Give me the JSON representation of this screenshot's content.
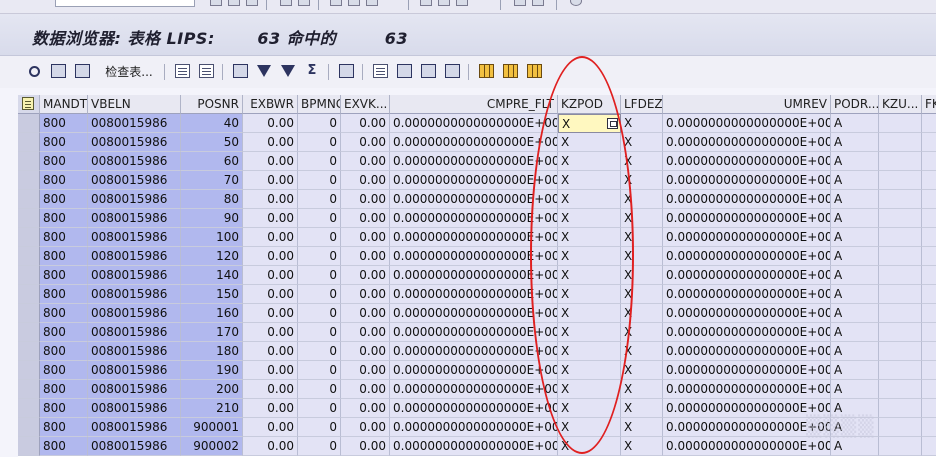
{
  "title": {
    "text": "数据浏览器: 表格 LIPS:       63 命中的        63"
  },
  "toolbar": {
    "check_table_label": "检查表...",
    "icons": [
      "display-icon",
      "find-icon",
      "refresh-icon",
      "check-table-icon",
      "details-icon",
      "choose-icon",
      "print-icon",
      "filter-icon",
      "set-filter-icon",
      "sum-icon",
      "ABC-analysis-icon",
      "export-icon",
      "sort-icon",
      "layout-icon",
      "grid-icon",
      "change-layout-icon",
      "select-layout-icon"
    ]
  },
  "table": {
    "columns": [
      "MANDT",
      "VBELN",
      "POSNR",
      "EXBWR",
      "BPMNG",
      "EXVK...",
      "CMPRE_FLT",
      "KZPOD",
      "LFDEZ",
      "UMREV",
      "PODR...",
      "KZU...",
      "FK"
    ],
    "rows": [
      [
        "800",
        "0080015986",
        "40",
        "0.00",
        "0",
        "0.00",
        "0.0000000000000000E+00",
        "X",
        "X",
        "0.0000000000000000E+00",
        "A",
        "",
        ""
      ],
      [
        "800",
        "0080015986",
        "50",
        "0.00",
        "0",
        "0.00",
        "0.0000000000000000E+00",
        "X",
        "X",
        "0.0000000000000000E+00",
        "A",
        "",
        ""
      ],
      [
        "800",
        "0080015986",
        "60",
        "0.00",
        "0",
        "0.00",
        "0.0000000000000000E+00",
        "X",
        "X",
        "0.0000000000000000E+00",
        "A",
        "",
        ""
      ],
      [
        "800",
        "0080015986",
        "70",
        "0.00",
        "0",
        "0.00",
        "0.0000000000000000E+00",
        "X",
        "X",
        "0.0000000000000000E+00",
        "A",
        "",
        ""
      ],
      [
        "800",
        "0080015986",
        "80",
        "0.00",
        "0",
        "0.00",
        "0.0000000000000000E+00",
        "X",
        "X",
        "0.0000000000000000E+00",
        "A",
        "",
        ""
      ],
      [
        "800",
        "0080015986",
        "90",
        "0.00",
        "0",
        "0.00",
        "0.0000000000000000E+00",
        "X",
        "X",
        "0.0000000000000000E+00",
        "A",
        "",
        ""
      ],
      [
        "800",
        "0080015986",
        "100",
        "0.00",
        "0",
        "0.00",
        "0.0000000000000000E+00",
        "X",
        "X",
        "0.0000000000000000E+00",
        "A",
        "",
        ""
      ],
      [
        "800",
        "0080015986",
        "120",
        "0.00",
        "0",
        "0.00",
        "0.0000000000000000E+00",
        "X",
        "X",
        "0.0000000000000000E+00",
        "A",
        "",
        ""
      ],
      [
        "800",
        "0080015986",
        "140",
        "0.00",
        "0",
        "0.00",
        "0.0000000000000000E+00",
        "X",
        "X",
        "0.0000000000000000E+00",
        "A",
        "",
        ""
      ],
      [
        "800",
        "0080015986",
        "150",
        "0.00",
        "0",
        "0.00",
        "0.0000000000000000E+00",
        "X",
        "X",
        "0.0000000000000000E+00",
        "A",
        "",
        ""
      ],
      [
        "800",
        "0080015986",
        "160",
        "0.00",
        "0",
        "0.00",
        "0.0000000000000000E+00",
        "X",
        "X",
        "0.0000000000000000E+00",
        "A",
        "",
        ""
      ],
      [
        "800",
        "0080015986",
        "170",
        "0.00",
        "0",
        "0.00",
        "0.0000000000000000E+00",
        "X",
        "X",
        "0.0000000000000000E+00",
        "A",
        "",
        ""
      ],
      [
        "800",
        "0080015986",
        "180",
        "0.00",
        "0",
        "0.00",
        "0.0000000000000000E+00",
        "X",
        "X",
        "0.0000000000000000E+00",
        "A",
        "",
        ""
      ],
      [
        "800",
        "0080015986",
        "190",
        "0.00",
        "0",
        "0.00",
        "0.0000000000000000E+00",
        "X",
        "X",
        "0.0000000000000000E+00",
        "A",
        "",
        ""
      ],
      [
        "800",
        "0080015986",
        "200",
        "0.00",
        "0",
        "0.00",
        "0.0000000000000000E+00",
        "X",
        "X",
        "0.0000000000000000E+00",
        "A",
        "",
        ""
      ],
      [
        "800",
        "0080015986",
        "210",
        "0.00",
        "0",
        "0.00",
        "0.0000000000000000E+00",
        "X",
        "X",
        "0.0000000000000000E+00",
        "A",
        "",
        ""
      ],
      [
        "800",
        "0080015986",
        "900001",
        "0.00",
        "0",
        "0.00",
        "0.0000000000000000E+00",
        "X",
        "X",
        "0.0000000000000000E+00",
        "A",
        "",
        ""
      ],
      [
        "800",
        "0080015986",
        "900002",
        "0.00",
        "0",
        "0.00",
        "0.0000000000000000E+00",
        "X",
        "X",
        "0.0000000000000000E+00",
        "A",
        "",
        ""
      ]
    ]
  },
  "colors": {
    "key_column": "#b1b8ee",
    "annotation": "#e02020",
    "current_cell": "#fff8c0"
  }
}
